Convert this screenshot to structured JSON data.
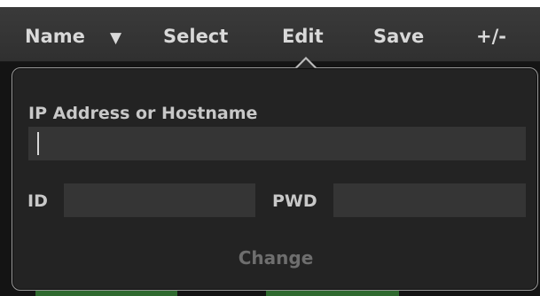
{
  "toolbar": {
    "name_label": "Name",
    "sort_icon_glyph": "▼",
    "select_label": "Select",
    "edit_label": "Edit",
    "save_label": "Save",
    "plusminus_label": "+/-"
  },
  "popover": {
    "ip_label": "IP Address or Hostname",
    "ip_value": "",
    "id_label": "ID",
    "id_value": "",
    "pwd_label": "PWD",
    "pwd_value": "",
    "change_label": "Change"
  },
  "colors": {
    "toolbar_bg": "#333333",
    "toolbar_text": "#d9d9d9",
    "popover_bg": "#232323",
    "popover_border": "#9a9a9a",
    "field_bg": "#353535",
    "label_text": "#c8c8c8",
    "disabled_text": "#6e6e6e",
    "hint_green": "#2f6a2f"
  },
  "icons": {
    "sort": "sort-down-triangle-icon",
    "pointer": "popover-pointer-icon"
  }
}
